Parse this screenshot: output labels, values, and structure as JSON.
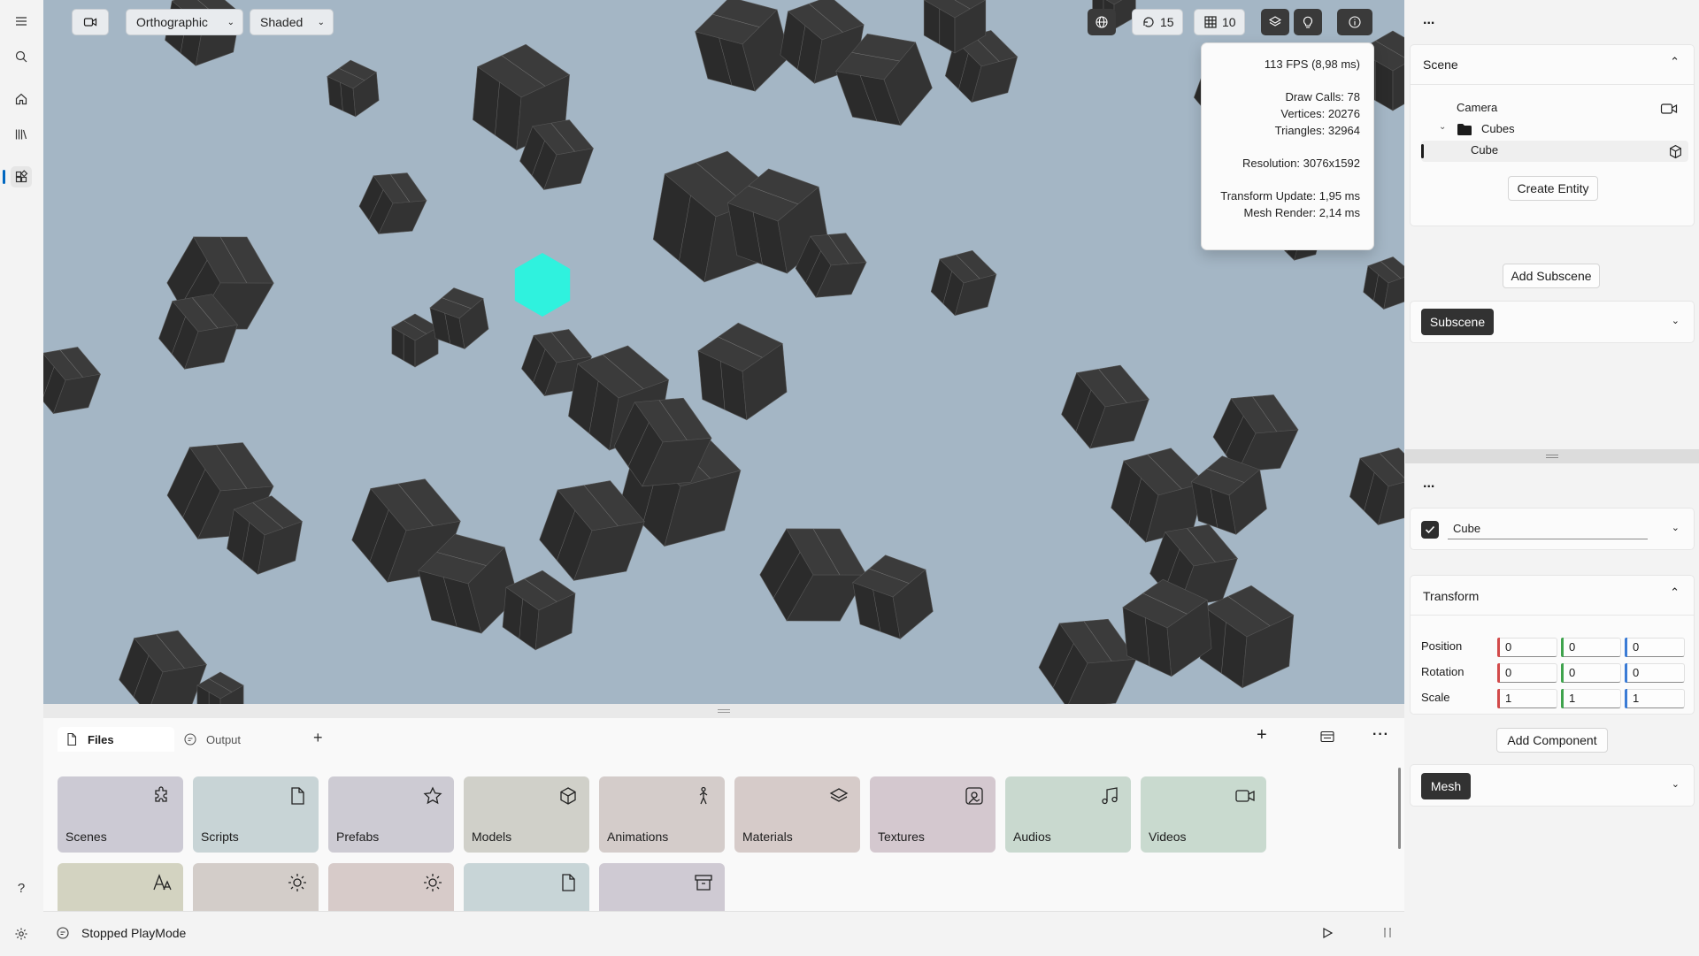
{
  "viewport": {
    "projection": "Orthographic",
    "shading": "Shaded",
    "gizmo_count": "15",
    "grid_count": "10",
    "background_color": "#a4b6c5",
    "selected_color": "#2ff2de"
  },
  "stats": {
    "fps": "113 FPS (8,98 ms)",
    "draw_calls": "Draw Calls: 78",
    "vertices": "Vertices: 20276",
    "triangles": "Triangles: 32964",
    "resolution": "Resolution: 3076x1592",
    "transform_update": "Transform Update: 1,95 ms",
    "mesh_render": "Mesh Render: 2,14 ms"
  },
  "scene": {
    "more": "...",
    "title": "Scene",
    "tree": [
      {
        "label": "Camera",
        "icon": "camera-icon"
      },
      {
        "label": "Cubes",
        "icon": "folder-icon"
      },
      {
        "label": "Cube",
        "icon": "cube-icon"
      }
    ],
    "create_entity": "Create Entity",
    "add_subscene": "Add Subscene",
    "subscene": "Subscene"
  },
  "inspector": {
    "more": "...",
    "entity_name": "Cube",
    "enabled": true,
    "transform_title": "Transform",
    "rows": [
      {
        "label": "Position",
        "x": "0",
        "y": "0",
        "z": "0"
      },
      {
        "label": "Rotation",
        "x": "0",
        "y": "0",
        "z": "0"
      },
      {
        "label": "Scale",
        "x": "1",
        "y": "1",
        "z": "1"
      }
    ],
    "add_component": "Add Component",
    "mesh": "Mesh"
  },
  "bottom": {
    "tabs": [
      "Files",
      "Output"
    ],
    "tiles": [
      {
        "label": "Scenes",
        "color": "#cccad4",
        "icon": "puzzle-icon"
      },
      {
        "label": "Scripts",
        "color": "#c8d4d6",
        "icon": "document-icon"
      },
      {
        "label": "Prefabs",
        "color": "#cdcbd3",
        "icon": "star-icon"
      },
      {
        "label": "Models",
        "color": "#d0d0c9",
        "icon": "cube-icon"
      },
      {
        "label": "Animations",
        "color": "#d4ccca",
        "icon": "person-icon"
      },
      {
        "label": "Materials",
        "color": "#d6cbc9",
        "icon": "layers-icon"
      },
      {
        "label": "Textures",
        "color": "#d4c8cf",
        "icon": "image-icon"
      },
      {
        "label": "Audios",
        "color": "#c9d9cf",
        "icon": "music-icon"
      },
      {
        "label": "Videos",
        "color": "#c9dacf",
        "icon": "video-icon"
      },
      {
        "label": "",
        "color": "#d3d3c1",
        "icon": "font-icon"
      },
      {
        "label": "",
        "color": "#d3cdc9",
        "icon": "sun-icon"
      },
      {
        "label": "",
        "color": "#d7cbc9",
        "icon": "sun-icon"
      },
      {
        "label": "",
        "color": "#c8d5d7",
        "icon": "document-icon"
      },
      {
        "label": "",
        "color": "#cfcad3",
        "icon": "archive-icon"
      }
    ]
  },
  "status": {
    "text": "Stopped PlayMode"
  }
}
